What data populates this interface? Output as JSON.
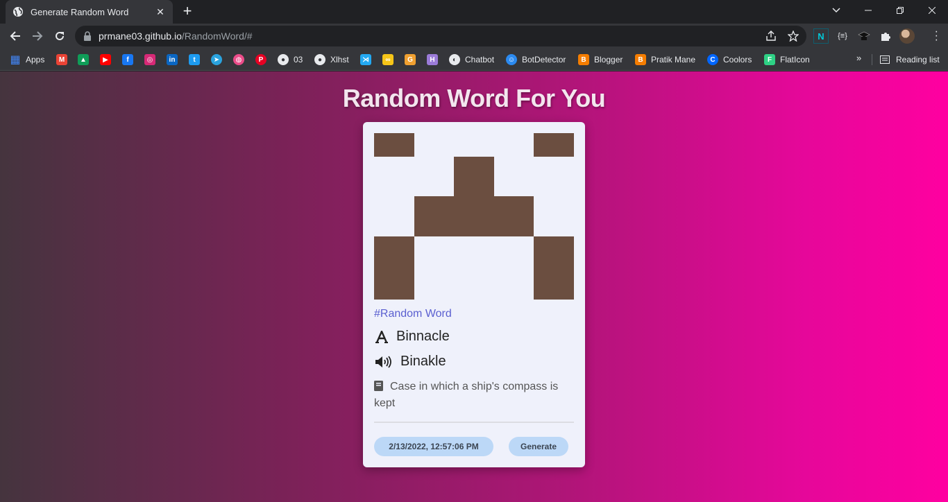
{
  "browser": {
    "tab_title": "Generate Random Word",
    "new_tab_symbol": "+",
    "close_symbol": "✕",
    "url_host": "prmane03.github.io",
    "url_path": "/RandomWord/#",
    "bookmarks_more": "»",
    "reading_list": "Reading list"
  },
  "bookmarks": [
    {
      "label": "Apps",
      "icon": "apps-grid-icon",
      "color": "#4285f4"
    },
    {
      "label": "",
      "icon": "gmail-icon",
      "color": "#ea4335"
    },
    {
      "label": "",
      "icon": "google-drive-icon",
      "color": "#0f9d58"
    },
    {
      "label": "",
      "icon": "youtube-icon",
      "color": "#ff0000"
    },
    {
      "label": "",
      "icon": "facebook-icon",
      "color": "#1877f2"
    },
    {
      "label": "",
      "icon": "instagram-icon",
      "color": "#d62976"
    },
    {
      "label": "",
      "icon": "linkedin-icon",
      "color": "#0a66c2"
    },
    {
      "label": "",
      "icon": "twitter-icon",
      "color": "#1d9bf0"
    },
    {
      "label": "",
      "icon": "telegram-icon",
      "color": "#2aa3de"
    },
    {
      "label": "",
      "icon": "dribbble-icon",
      "color": "#ea4c89"
    },
    {
      "label": "",
      "icon": "pinterest-icon",
      "color": "#e60023"
    },
    {
      "label": "03",
      "icon": "github-icon",
      "color": "#e8eaed"
    },
    {
      "label": "Xlhst",
      "icon": "github-icon",
      "color": "#e8eaed"
    },
    {
      "label": "",
      "icon": "vscode-icon",
      "color": "#23a9f2"
    },
    {
      "label": "",
      "icon": "codepen-icon",
      "color": "#f5c518"
    },
    {
      "label": "",
      "icon": "grammarly-icon",
      "color": "#f0a030"
    },
    {
      "label": "",
      "icon": "heroku-icon",
      "color": "#9b7bd8"
    },
    {
      "label": "Chatbot",
      "icon": "globe-icon",
      "color": "#e8eaed"
    },
    {
      "label": "BotDetector",
      "icon": "bot-icon",
      "color": "#2b8af0"
    },
    {
      "label": "Blogger",
      "icon": "blogger-icon",
      "color": "#f57d00"
    },
    {
      "label": "Pratik Mane",
      "icon": "blogger-icon",
      "color": "#f57d00"
    },
    {
      "label": "Coolors",
      "icon": "coolors-icon",
      "color": "#0066ff"
    },
    {
      "label": "FlatIcon",
      "icon": "flaticon-icon",
      "color": "#2ed185"
    }
  ],
  "page": {
    "title": "Random Word For You",
    "tag": "#Random Word",
    "word": "Binnacle",
    "pronunciation": "Binakle",
    "meaning": "Case in which a ship's compass is kept",
    "timestamp": "2/13/2022, 12:57:06 PM",
    "generate_label": "Generate",
    "identicon_color": "#6b4e40",
    "card_bg": "#eff1fb",
    "accent": "#5a5fd0"
  }
}
